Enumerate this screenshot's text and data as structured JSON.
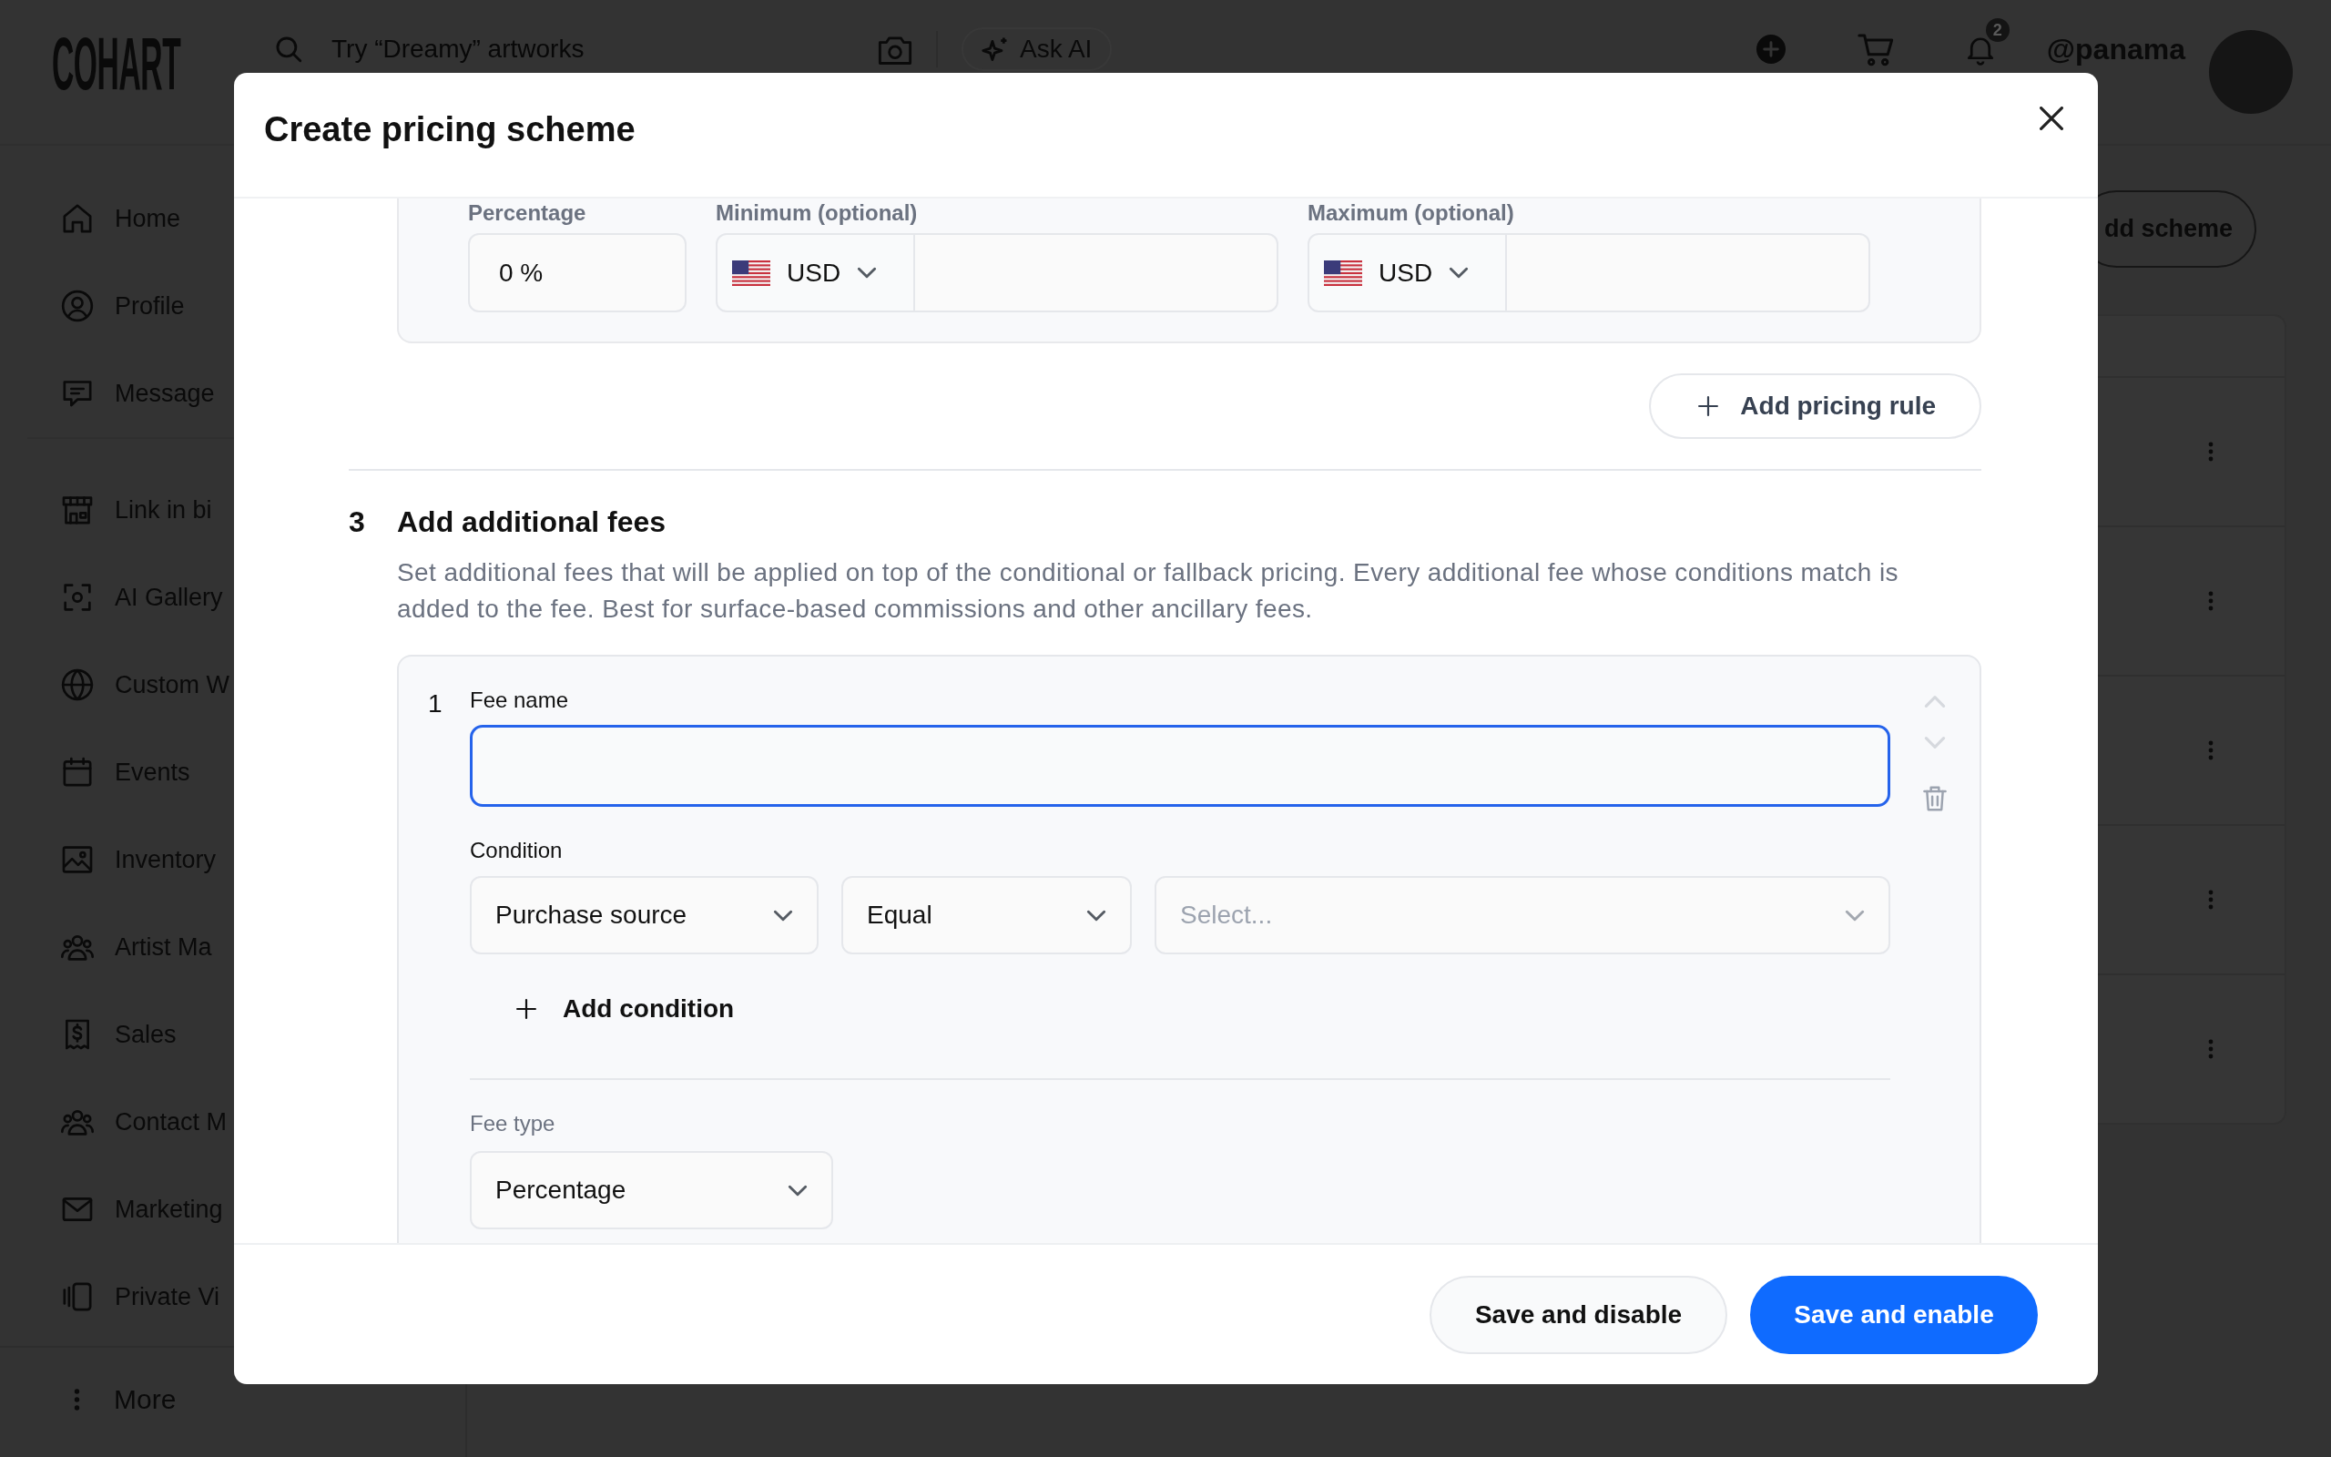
{
  "topbar": {
    "logo": "COHART",
    "search": {
      "placeholder": "Try “Dreamy” artworks"
    },
    "ask_ai": "Ask AI",
    "notification_count": "2",
    "username": "@panama"
  },
  "sidebar": {
    "sections": [
      {
        "items": [
          {
            "label": "Home"
          },
          {
            "label": "Profile"
          },
          {
            "label": "Message"
          }
        ]
      },
      {
        "items": [
          {
            "label": "Link in bi"
          },
          {
            "label": "AI Gallery"
          },
          {
            "label": "Custom W"
          },
          {
            "label": "Events"
          },
          {
            "label": "Inventory"
          },
          {
            "label": "Artist Ma"
          },
          {
            "label": "Sales"
          },
          {
            "label": "Contact M"
          },
          {
            "label": "Marketing"
          },
          {
            "label": "Private Vi"
          }
        ]
      }
    ],
    "more": "More"
  },
  "main": {
    "add_button": "dd scheme"
  },
  "modal": {
    "title": "Create pricing scheme",
    "pricing_rule": {
      "fields": [
        {
          "kind": "percent",
          "label": "Percentage",
          "value": "0 %"
        },
        {
          "kind": "money",
          "label": "Minimum (optional)",
          "currency": "USD"
        },
        {
          "kind": "money",
          "label": "Maximum (optional)",
          "currency": "USD"
        }
      ],
      "add_button": "Add pricing rule"
    },
    "section": {
      "number": "3",
      "title": "Add additional fees",
      "description": "Set additional fees that will be applied on top of the conditional or fallback pricing. Every additional fee whose conditions match is added to the fee. Best for surface-based commissions and other ancillary fees."
    },
    "fees": [
      {
        "number": "1",
        "name_field": {
          "label": "Fee name",
          "focused": true
        },
        "move_up": {
          "disabled": true
        },
        "move_down": {
          "disabled": true
        },
        "condition_label": "Condition",
        "conditions": [
          {
            "field": "Purchase source",
            "operator": "Equal",
            "value": {
              "placeholder": "Select..."
            }
          }
        ],
        "add_condition": "Add condition",
        "fee_type": {
          "label": "Fee type",
          "value": "Percentage"
        }
      }
    ],
    "footer": {
      "buttons": [
        {
          "label": "Save and disable",
          "kind": "secondary"
        },
        {
          "label": "Save and enable",
          "kind": "primary"
        }
      ]
    }
  }
}
